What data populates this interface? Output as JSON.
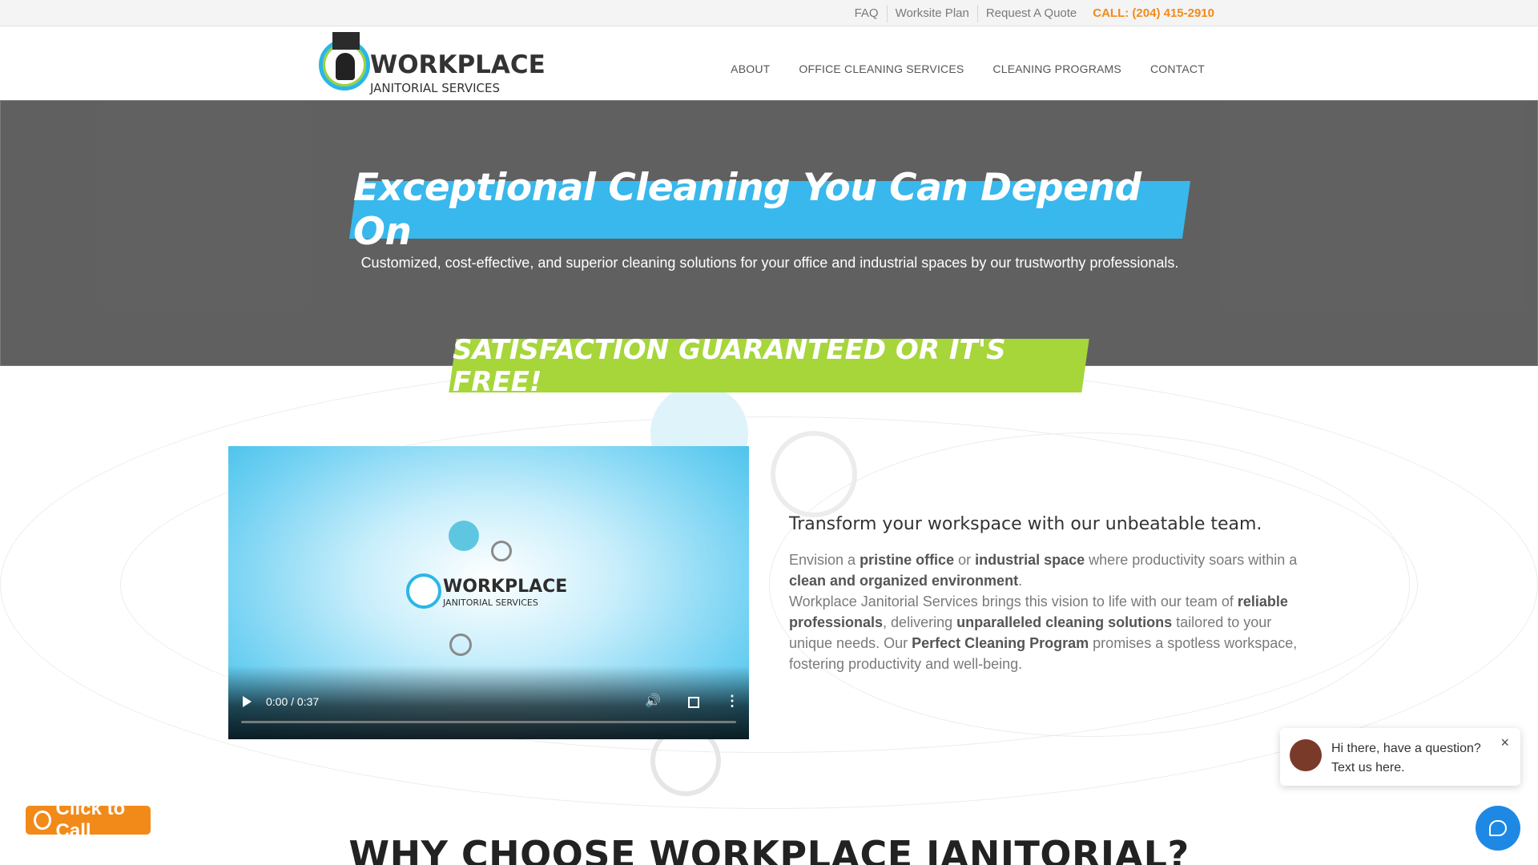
{
  "topbar": {
    "links": [
      "FAQ",
      "Worksite Plan",
      "Request A Quote"
    ],
    "call": "CALL: (204) 415-2910"
  },
  "logo": {
    "line1": "WORKPLACE",
    "line2": "JANITORIAL SERVICES"
  },
  "nav": {
    "items": [
      "ABOUT",
      "OFFICE CLEANING SERVICES",
      "CLEANING PROGRAMS",
      "CONTACT"
    ]
  },
  "hero": {
    "headline": "Exceptional Cleaning You Can Depend On",
    "subheadline": "Customized, cost-effective, and superior cleaning solutions for your office and industrial spaces by our trustworthy professionals.",
    "guarantee": "SATISFACTION GUARANTEED OR IT'S FREE!"
  },
  "video": {
    "logo_line1": "WORKPLACE",
    "logo_line2": "JANITORIAL SERVICES",
    "time": "0:00 / 0:37"
  },
  "intro": {
    "heading": "Transform your workspace with our unbeatable team.",
    "p1_a": "Envision a ",
    "p1_b": "pristine office",
    "p1_c": " or ",
    "p1_d": "industrial space",
    "p1_e": " where productivity soars within a ",
    "p1_f": "clean and organized environment",
    "p1_g": ".",
    "p2_a": "Workplace Janitorial Services brings this vision to life with our team of ",
    "p2_b": "reliable professionals",
    "p2_c": ", delivering ",
    "p2_d": "unparalleled cleaning solutions",
    "p2_e": " tailored to your unique needs. Our ",
    "p2_f": "Perfect Cleaning Program",
    "p2_g": " promises a spotless workspace, fostering productivity and well-being."
  },
  "section": {
    "why_heading": "WHY CHOOSE WORKPLACE JANITORIAL?"
  },
  "click_to_call": {
    "label": "Click to Call"
  },
  "chat": {
    "line1": "Hi there, have a question?",
    "line2": "Text us here.",
    "close": "×"
  },
  "colors": {
    "accent_blue": "#38b8ec",
    "accent_green": "#a6d63a",
    "call_orange": "#f28a1a",
    "chat_blue": "#1e88e5"
  },
  "icons": [
    "play-icon",
    "volume-icon",
    "fullscreen-icon",
    "more-icon",
    "phone-icon",
    "chat-icon",
    "close-icon"
  ]
}
